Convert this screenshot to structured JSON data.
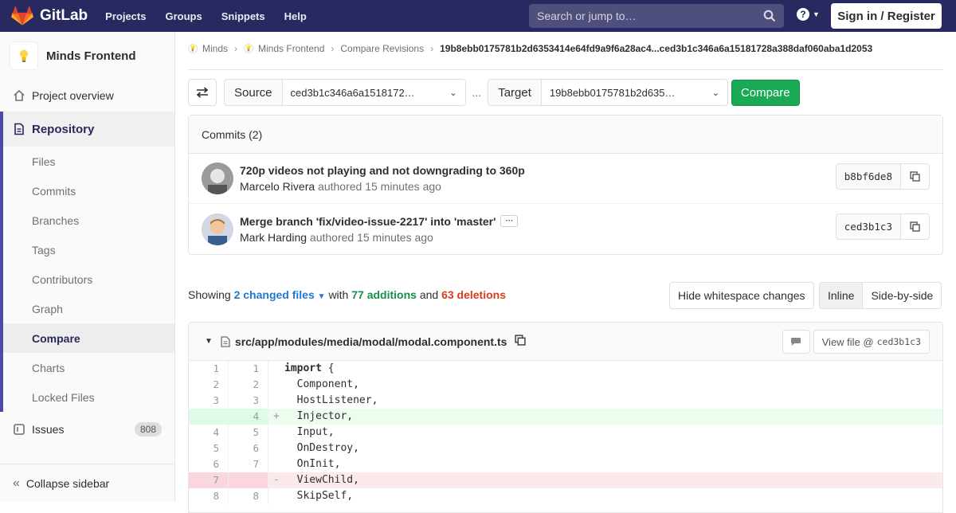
{
  "navbar": {
    "logo_text": "GitLab",
    "links": [
      "Projects",
      "Groups",
      "Snippets",
      "Help"
    ],
    "search_placeholder": "Search or jump to…",
    "help_symbol": "?",
    "signin_label": "Sign in / Register",
    "bg_color": "#292961"
  },
  "sidebar": {
    "project_name": "Minds Frontend",
    "project_overview": "Project overview",
    "repository": "Repository",
    "repo_items": [
      "Files",
      "Commits",
      "Branches",
      "Tags",
      "Contributors",
      "Graph",
      "Compare",
      "Charts",
      "Locked Files"
    ],
    "active_item": "Compare",
    "issues_label": "Issues",
    "issues_count": "808",
    "collapse_label": "Collapse sidebar"
  },
  "breadcrumb": {
    "items": [
      "Minds",
      "Minds Frontend",
      "Compare Revisions"
    ],
    "current": "19b8ebb0175781b2d6353414e64fd9a9f6a28ac4...ced3b1c346a6a15181728a388daf060aba1d2053"
  },
  "compare": {
    "source_label": "Source",
    "source_ref": "ced3b1c346a6a1518172…",
    "separator": "...",
    "target_label": "Target",
    "target_ref": "19b8ebb0175781b2d635…",
    "compare_button": "Compare",
    "button_color": "#1aaa55"
  },
  "commits": {
    "header": "Commits (2)",
    "items": [
      {
        "title": "720p videos not playing and not downgrading to 360p",
        "author": "Marcelo Rivera",
        "authored": "authored",
        "time": "15 minutes ago",
        "sha": "b8bf6de8"
      },
      {
        "title": "Merge branch 'fix/video-issue-2217' into 'master'",
        "author": "Mark Harding",
        "authored": "authored",
        "time": "15 minutes ago",
        "sha": "ced3b1c3"
      }
    ]
  },
  "summary": {
    "showing": "Showing",
    "changed_files": "2 changed files",
    "with": "with",
    "additions": "77 additions",
    "and": "and",
    "deletions": "63 deletions",
    "hide_whitespace": "Hide whitespace changes",
    "inline": "Inline",
    "side_by_side": "Side-by-side"
  },
  "file": {
    "path": "src/app/modules/media/modal/modal.component.ts",
    "view_file_label": "View file @",
    "view_file_sha": "ced3b1c3",
    "lines": [
      {
        "old": "1",
        "new": "1",
        "type": "ctx",
        "marker": "",
        "code": "import {"
      },
      {
        "old": "2",
        "new": "2",
        "type": "ctx",
        "marker": "",
        "code": "  Component,"
      },
      {
        "old": "3",
        "new": "3",
        "type": "ctx",
        "marker": "",
        "code": "  HostListener,"
      },
      {
        "old": "",
        "new": "4",
        "type": "add",
        "marker": "+",
        "code": "  Injector,"
      },
      {
        "old": "4",
        "new": "5",
        "type": "ctx",
        "marker": "",
        "code": "  Input,"
      },
      {
        "old": "5",
        "new": "6",
        "type": "ctx",
        "marker": "",
        "code": "  OnDestroy,"
      },
      {
        "old": "6",
        "new": "7",
        "type": "ctx",
        "marker": "",
        "code": "  OnInit,"
      },
      {
        "old": "7",
        "new": "",
        "type": "del",
        "marker": "-",
        "code": "  ViewChild,"
      },
      {
        "old": "8",
        "new": "8",
        "type": "ctx",
        "marker": "",
        "code": "  SkipSelf,"
      }
    ]
  }
}
